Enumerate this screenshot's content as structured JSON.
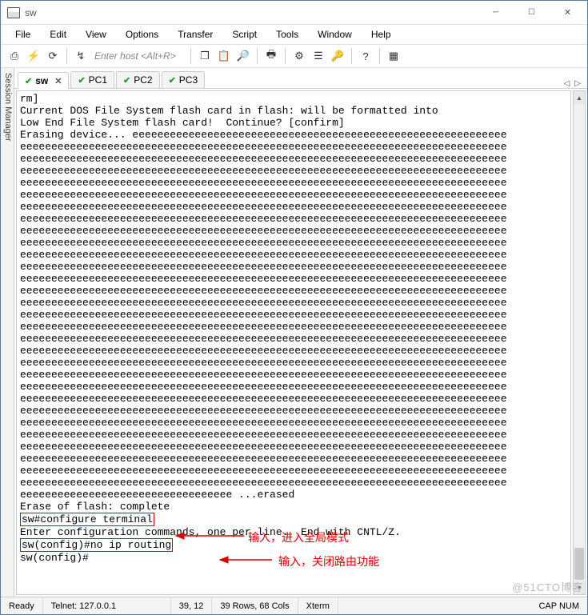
{
  "window": {
    "title": "sw"
  },
  "menus": {
    "file": "File",
    "edit": "Edit",
    "view": "View",
    "options": "Options",
    "transfer": "Transfer",
    "script": "Script",
    "tools": "Tools",
    "window": "Window",
    "help": "Help"
  },
  "toolbar": {
    "hostPlaceholder": "Enter host <Alt+R>"
  },
  "sessionManager": {
    "label": "Session Manager"
  },
  "tabs": [
    {
      "id": "sw",
      "label": "sw",
      "active": true,
      "closeable": true
    },
    {
      "id": "pc1",
      "label": "PC1",
      "active": false,
      "closeable": false
    },
    {
      "id": "pc2",
      "label": "PC2",
      "active": false,
      "closeable": false
    },
    {
      "id": "pc3",
      "label": "PC3",
      "active": false,
      "closeable": false
    }
  ],
  "tabnav": {
    "prev": "◁",
    "next": "▷"
  },
  "terminal": {
    "pre": "rm]\nCurrent DOS File System flash card in flash: will be formatted into\nLow End File System flash card!  Continue? [confirm]",
    "erasing": "Erasing device... ",
    "eLineFirst": "eeeeeeeeeeeeeeeeeeeeeeeeeeeeeeeeeeeeeeeeeeeeeeeeeeeeeeeeeeee",
    "eLine": "eeeeeeeeeeeeeeeeeeeeeeeeeeeeeeeeeeeeeeeeeeeeeeeeeeeeeeeeeeeeeeeeeeeeeeeeeeeeee",
    "eLineLast": "eeeeeeeeeeeeeeeeeeeeeeeeeeeeeeeeee ...erased",
    "eraseComplete": "Erase of flash: complete",
    "confTerm": "sw#configure terminal",
    "enterCfg": "Enter configuration commands, one per line.  End with CNTL/Z.",
    "noIpRouting": "sw(config)#no ip routing",
    "promptEnd": "sw(config)#"
  },
  "annotations": {
    "a1": "输入，进入全局模式",
    "a2": "输入，关闭路由功能"
  },
  "status": {
    "ready": "Ready",
    "conn": "Telnet: 127.0.0.1",
    "pos": "39, 12",
    "size": "39 Rows, 68 Cols",
    "term": "Xterm",
    "caps": "CAP  NUM"
  },
  "watermark": "@51CTO博客"
}
